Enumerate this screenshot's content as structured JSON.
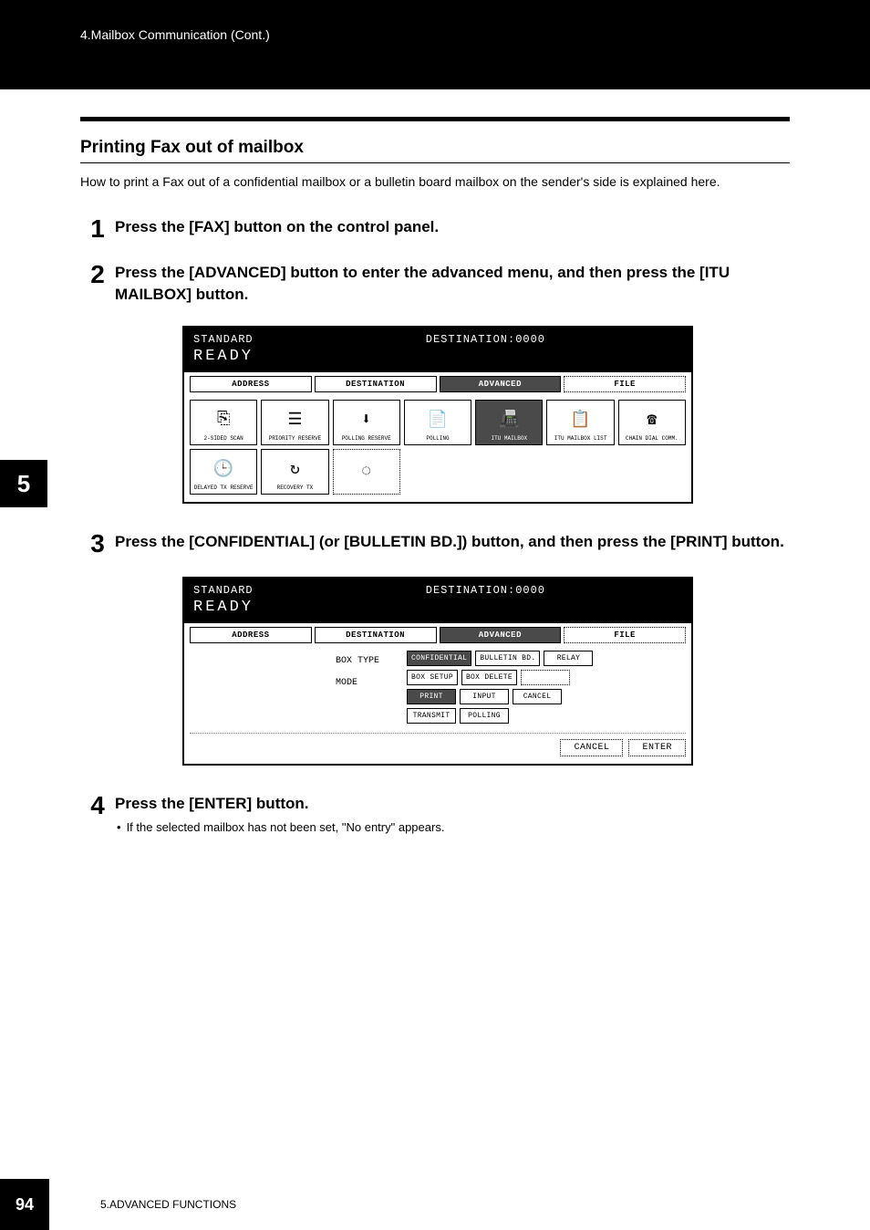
{
  "header": {
    "breadcrumb": "4.Mailbox Communication (Cont.)"
  },
  "side_tab": "5",
  "section": {
    "heading": "Printing Fax out of mailbox",
    "intro": "How to print a Fax out of a confidential mailbox or a bulletin board mailbox on the sender's side is explained here."
  },
  "steps": [
    {
      "number": "1",
      "title": "Press the [FAX] button on the control panel."
    },
    {
      "number": "2",
      "title": "Press the [ADVANCED] button to enter the advanced menu, and then press the [ITU MAILBOX] button."
    },
    {
      "number": "3",
      "title": "Press the [CONFIDENTIAL] (or [BULLETIN BD.]) button, and then press the [PRINT] button."
    },
    {
      "number": "4",
      "title": "Press the [ENTER] button.",
      "note": "If the selected mailbox has not been set, \"No entry\" appears."
    }
  ],
  "screen1": {
    "status_left": "STANDARD",
    "status_right": "DESTINATION:0000",
    "ready": "READY",
    "tabs": [
      "ADDRESS",
      "DESTINATION",
      "ADVANCED",
      "FILE"
    ],
    "selected_tab": "ADVANCED",
    "icons_row1": [
      {
        "label": "2-SIDED SCAN",
        "glyph": "⎘"
      },
      {
        "label": "PRIORITY RESERVE",
        "glyph": "☰"
      },
      {
        "label": "POLLING RESERVE",
        "glyph": "⬇"
      },
      {
        "label": "POLLING",
        "glyph": "📄"
      },
      {
        "label": "ITU MAILBOX",
        "glyph": "📠",
        "selected": true
      },
      {
        "label": "ITU MAILBOX LIST",
        "glyph": "📋"
      },
      {
        "label": "CHAIN DIAL COMM.",
        "glyph": "☎"
      }
    ],
    "icons_row2": [
      {
        "label": "DELAYED TX RESERVE",
        "glyph": "🕒"
      },
      {
        "label": "RECOVERY TX",
        "glyph": "↻"
      },
      {
        "label": "",
        "glyph": "◌",
        "dotted": true
      }
    ]
  },
  "screen2": {
    "status_left": "STANDARD",
    "status_right": "DESTINATION:0000",
    "ready": "READY",
    "tabs": [
      "ADDRESS",
      "DESTINATION",
      "ADVANCED",
      "FILE"
    ],
    "selected_tab": "ADVANCED",
    "label_box_type": "BOX TYPE",
    "label_mode": "MODE",
    "box_type_buttons": [
      {
        "label": "CONFIDENTIAL",
        "selected": true
      },
      {
        "label": "BULLETIN BD."
      },
      {
        "label": "RELAY"
      }
    ],
    "mode_row1": [
      {
        "label": "BOX SETUP"
      },
      {
        "label": "BOX DELETE"
      },
      {
        "label": "",
        "dotted": true
      }
    ],
    "mode_row2": [
      {
        "label": "PRINT",
        "selected": true
      },
      {
        "label": "INPUT"
      },
      {
        "label": "CANCEL"
      }
    ],
    "mode_row3": [
      {
        "label": "TRANSMIT"
      },
      {
        "label": "POLLING"
      }
    ],
    "bottom": [
      {
        "label": "CANCEL"
      },
      {
        "label": "ENTER"
      }
    ]
  },
  "footer": {
    "page": "94",
    "chapter": "5.ADVANCED FUNCTIONS"
  }
}
